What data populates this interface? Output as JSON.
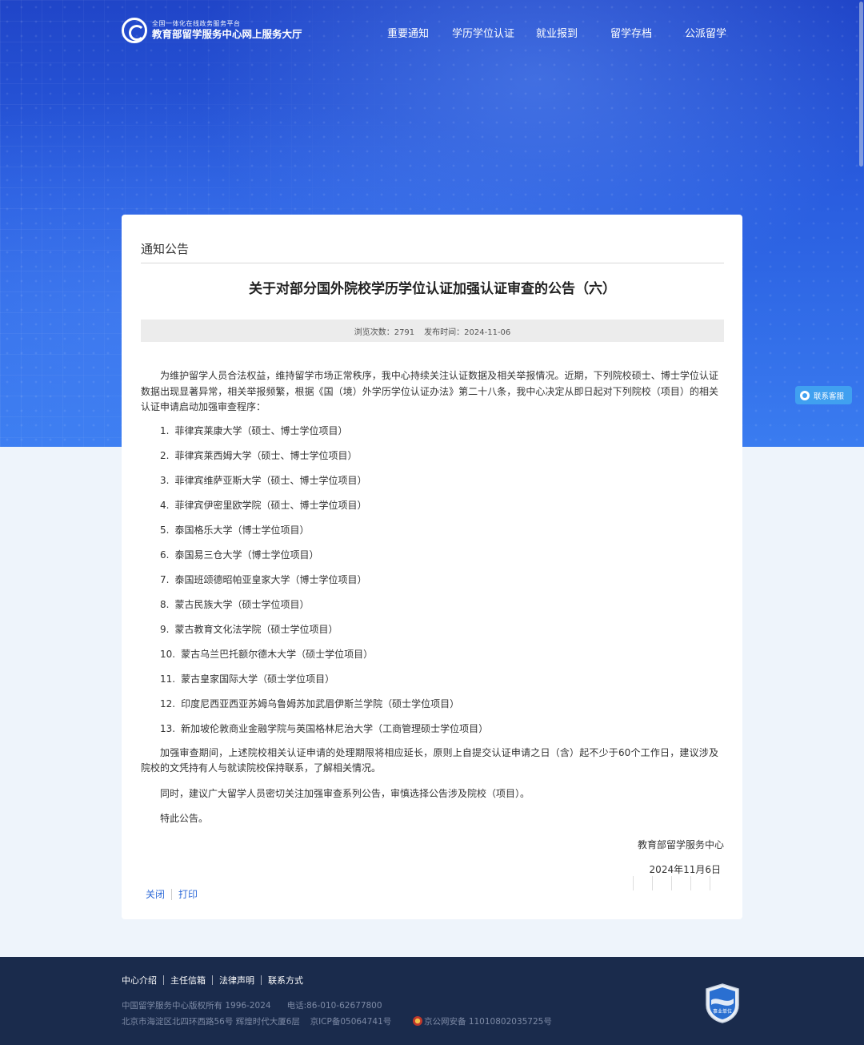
{
  "header": {
    "logo_sub": "全国一体化在线政务服务平台",
    "logo_main": "教育部留学服务中心网上服务大厅",
    "nav": [
      "重要通知",
      "学历学位认证",
      "就业报到",
      "留学存档",
      "公派留学"
    ]
  },
  "card": {
    "section": "通知公告",
    "title": "关于对部分国外院校学历学位认证加强认证审查的公告（六）",
    "views_label": "浏览次数：",
    "views": "2791",
    "date_label": "发布时间：",
    "date": "2024-11-06",
    "intro": "为维护留学人员合法权益，维持留学市场正常秩序，我中心持续关注认证数据及相关举报情况。近期，下列院校硕士、博士学位认证数据出现显著异常，相关举报频繁，根据《国（境）外学历学位认证办法》第二十八条，我中心决定从即日起对下列院校（项目）的相关认证申请启动加强审查程序：",
    "list": [
      {
        "num": "1.",
        "text": "菲律宾莱康大学（硕士、博士学位项目）"
      },
      {
        "num": "2.",
        "text": "菲律宾莱西姆大学（硕士、博士学位项目）"
      },
      {
        "num": "3.",
        "text": "菲律宾维萨亚斯大学（硕士、博士学位项目）"
      },
      {
        "num": "4.",
        "text": "菲律宾伊密里欧学院（硕士、博士学位项目）"
      },
      {
        "num": "5.",
        "text": "泰国格乐大学（博士学位项目）"
      },
      {
        "num": "6.",
        "text": "泰国易三仓大学（博士学位项目）"
      },
      {
        "num": "7.",
        "text": "泰国班颂德昭帕亚皇家大学（博士学位项目）"
      },
      {
        "num": "8.",
        "text": "蒙古民族大学（硕士学位项目）"
      },
      {
        "num": "9.",
        "text": "蒙古教育文化法学院（硕士学位项目）"
      },
      {
        "num": "10.",
        "text": "蒙古乌兰巴托额尔德木大学（硕士学位项目）"
      },
      {
        "num": "11.",
        "text": "蒙古皇家国际大学（硕士学位项目）"
      },
      {
        "num": "12.",
        "text": "印度尼西亚西亚苏姆乌鲁姆苏加武眉伊斯兰学院（硕士学位项目）"
      },
      {
        "num": "13.",
        "text": "新加坡伦敦商业金融学院与英国格林尼治大学（工商管理硕士学位项目）"
      }
    ],
    "para2": "加强审查期间，上述院校相关认证申请的处理期限将相应延长，原则上自提交认证申请之日（含）起不少于60个工作日，建议涉及院校的文凭持有人与就读院校保持联系，了解相关情况。",
    "para3": "同时，建议广大留学人员密切关注加强审查系列公告，审慎选择公告涉及院校（项目）。",
    "para4": "特此公告。",
    "sign_org": "教育部留学服务中心",
    "sign_date": "2024年11月6日",
    "close": "关闭",
    "print": "打印"
  },
  "contact": "联系客服",
  "footer": {
    "links": [
      "中心介绍",
      "主任信箱",
      "法律声明",
      "联系方式"
    ],
    "copyright": "中国留学服务中心版权所有 1996-2024",
    "phone": "电话:86-010-62677800",
    "address": "北京市海淀区北四环西路56号 辉煌时代大厦6层",
    "icp": "京ICP备05064741号",
    "police": "京公网安备 11010802035725号",
    "shield_label": "事业单位"
  },
  "colors": {
    "hero": "#2a5ee0",
    "link": "#2f6bd8",
    "footer": "#1a2b4c",
    "contact": "#40a0f0"
  }
}
